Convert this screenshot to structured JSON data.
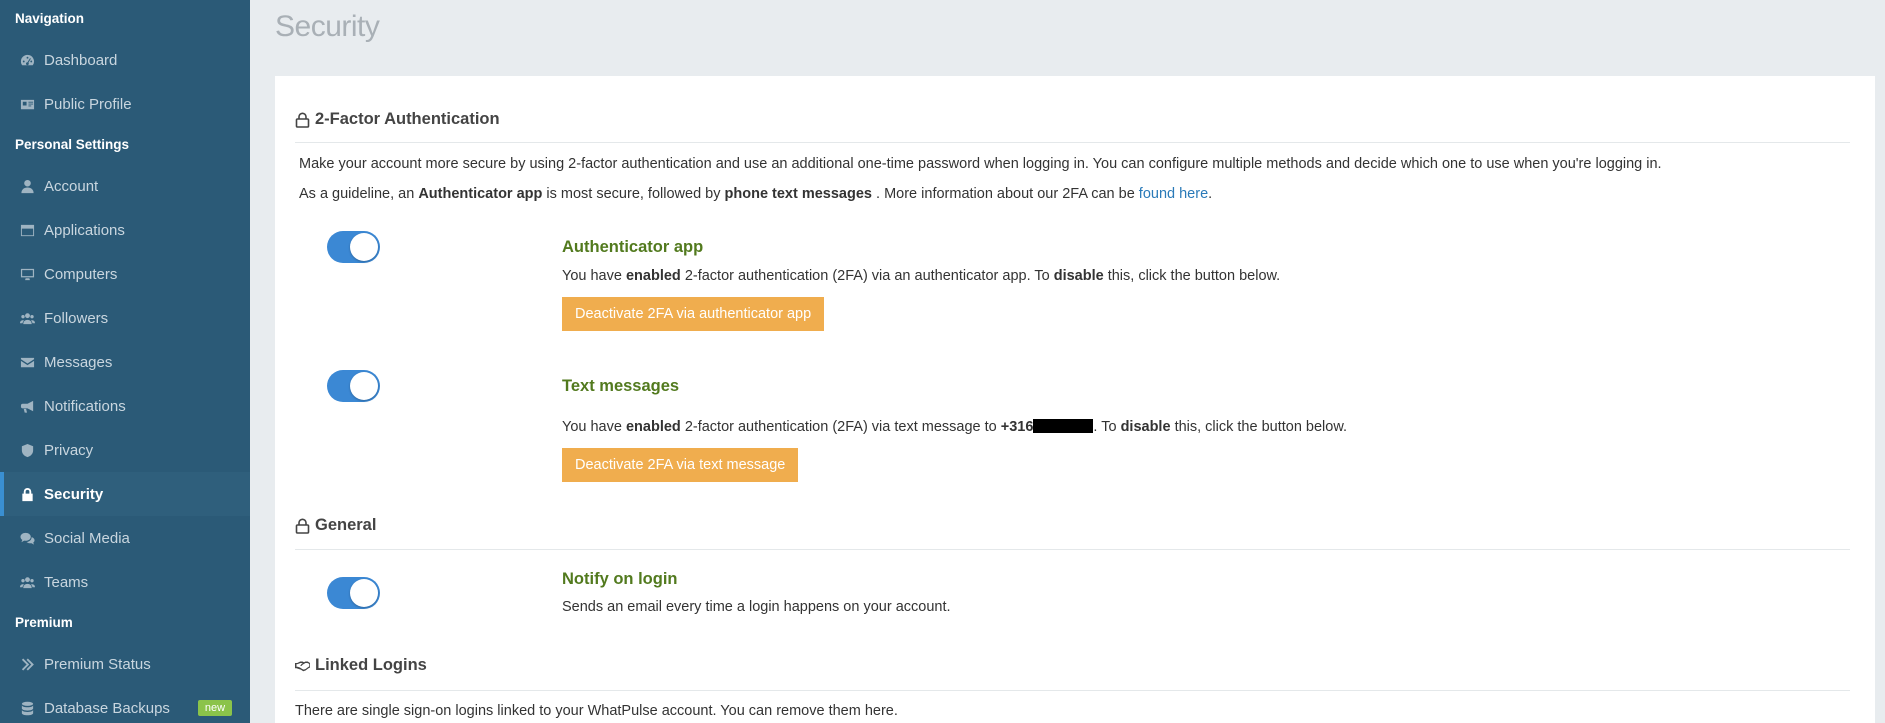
{
  "sidebar": {
    "headings": {
      "navigation": "Navigation",
      "personal": "Personal Settings",
      "premium": "Premium"
    },
    "navigation_items": [
      {
        "label": "Dashboard",
        "icon": "gauge-icon"
      },
      {
        "label": "Public Profile",
        "icon": "id-card-icon"
      }
    ],
    "personal_items": [
      {
        "label": "Account",
        "icon": "user-icon"
      },
      {
        "label": "Applications",
        "icon": "window-icon"
      },
      {
        "label": "Computers",
        "icon": "desktop-icon"
      },
      {
        "label": "Followers",
        "icon": "users-icon"
      },
      {
        "label": "Messages",
        "icon": "envelope-icon"
      },
      {
        "label": "Notifications",
        "icon": "megaphone-icon"
      },
      {
        "label": "Privacy",
        "icon": "shield-icon"
      },
      {
        "label": "Security",
        "icon": "lock-icon",
        "active": true
      },
      {
        "label": "Social Media",
        "icon": "comments-icon"
      },
      {
        "label": "Teams",
        "icon": "users-icon"
      }
    ],
    "premium_items": [
      {
        "label": "Premium Status",
        "icon": "double-chevron-icon"
      },
      {
        "label": "Database Backups",
        "icon": "database-icon",
        "badge": "new"
      }
    ]
  },
  "page": {
    "title": "Security"
  },
  "twofa": {
    "heading": "2-Factor Authentication",
    "intro": "Make your account more secure by using 2-factor authentication and use an additional one-time password when logging in. You can configure multiple methods and decide which one to use when you're logging in.",
    "guideline": {
      "prefix": "As a guideline, an",
      "strong1": "Authenticator app",
      "mid": "is most secure, followed by",
      "strong2": "phone text messages",
      "suffix": ". More information about our 2FA can be",
      "link": "found here",
      "end": "."
    },
    "authenticator": {
      "title": "Authenticator app",
      "enabled": true,
      "desc_prefix": "You have",
      "desc_enabled": "enabled",
      "desc_mid": "2-factor authentication (2FA) via an authenticator app. To",
      "desc_disable": "disable",
      "desc_suffix": "this, click the button below.",
      "button": "Deactivate 2FA via authenticator app"
    },
    "sms": {
      "title": "Text messages",
      "enabled": true,
      "desc_prefix": "You have",
      "desc_enabled": "enabled",
      "desc_mid": "2-factor authentication (2FA) via text message to",
      "phone": "+316",
      "desc_to": ". To",
      "desc_disable": "disable",
      "desc_suffix": "this, click the button below.",
      "button": "Deactivate 2FA via text message"
    }
  },
  "general": {
    "heading": "General",
    "notify": {
      "title": "Notify on login",
      "enabled": true,
      "desc": "Sends an email every time a login happens on your account."
    }
  },
  "linked": {
    "heading": "Linked Logins",
    "desc": "There are single sign-on logins linked to your WhatPulse account. You can remove them here."
  },
  "colors": {
    "sidebar_bg": "#2b5a77",
    "accent_blue": "#3b88d4",
    "button_orange": "#f0ad4e",
    "option_title_green": "#527a1e"
  }
}
